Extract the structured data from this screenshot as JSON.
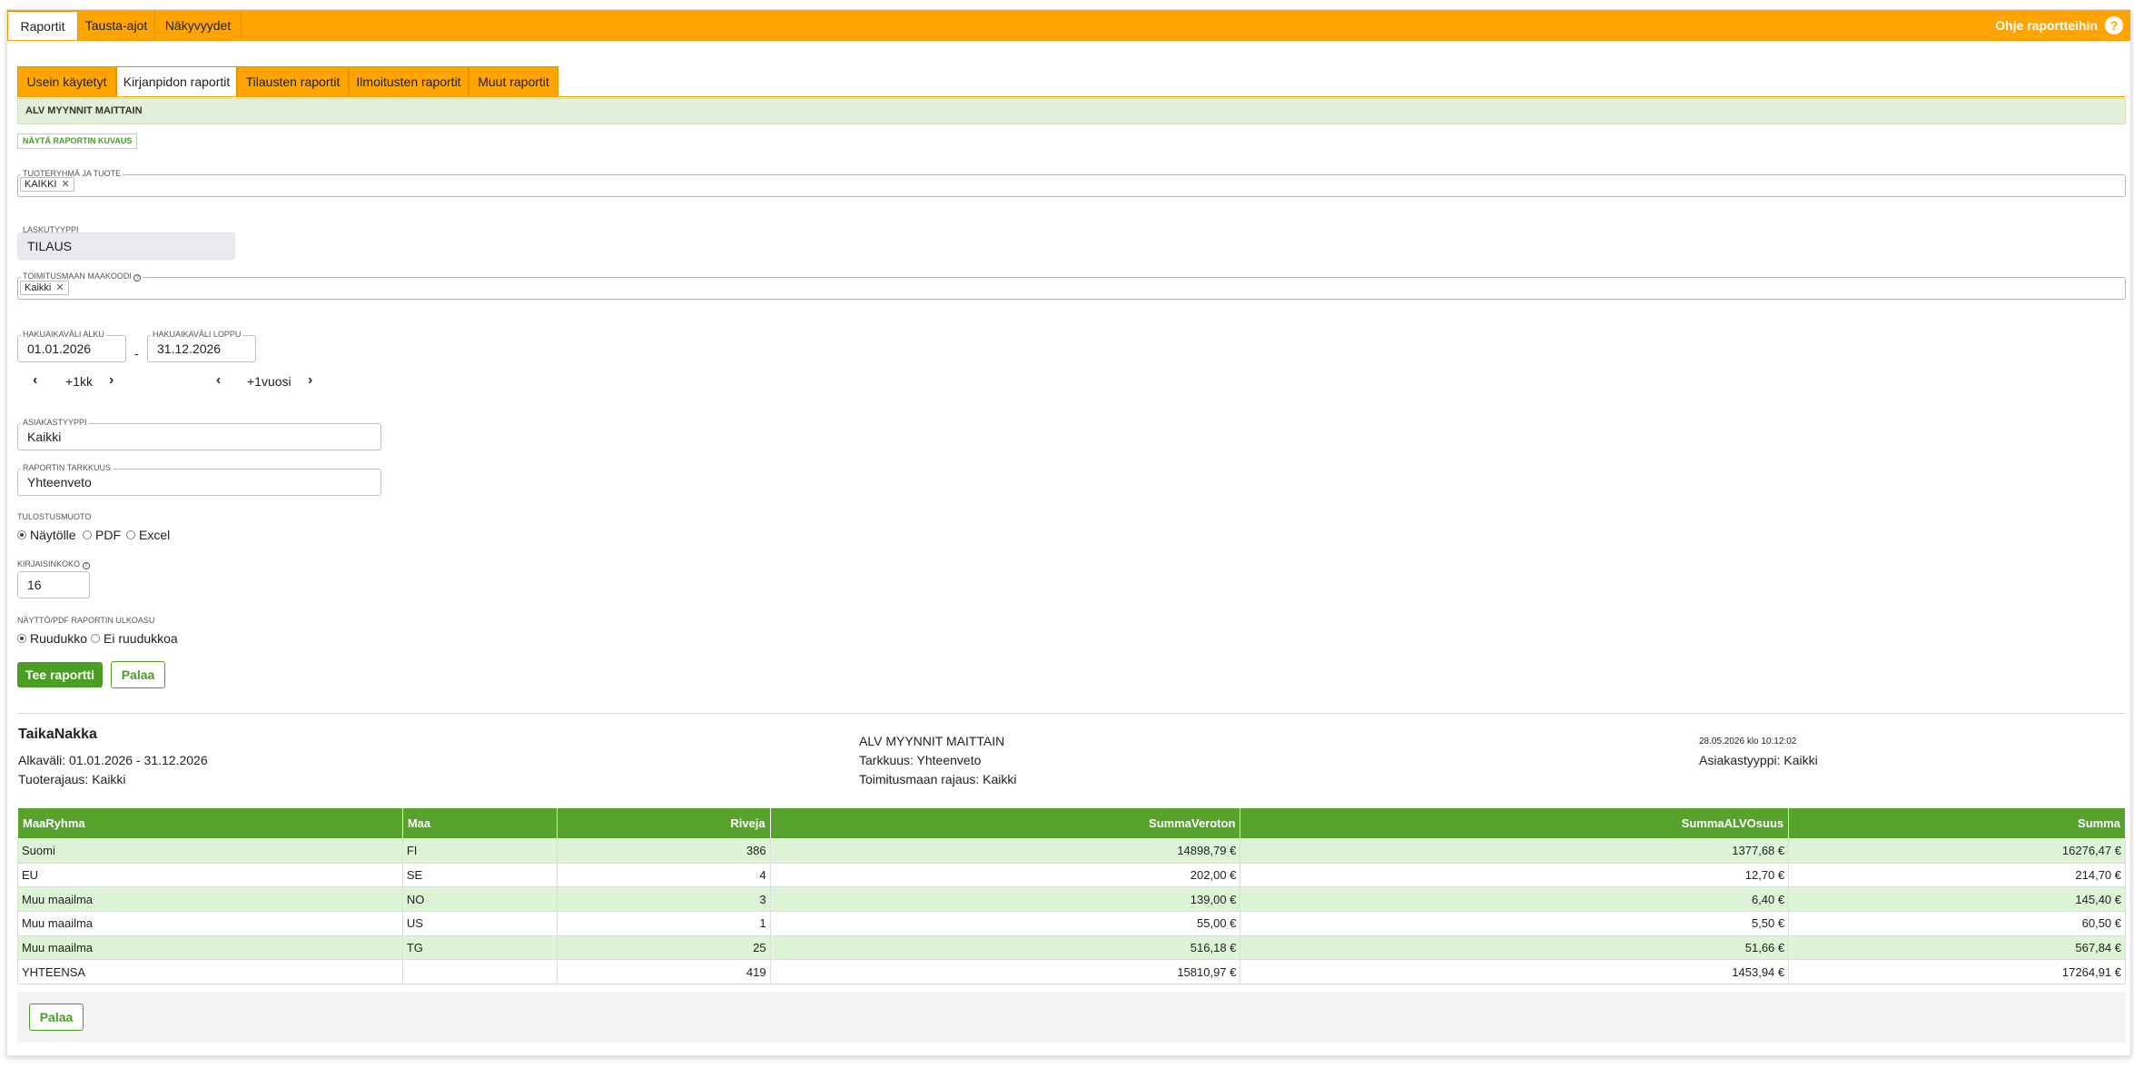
{
  "topbar": {
    "tabs": [
      "Raportit",
      "Tausta-ajot",
      "Näkyvyydet"
    ],
    "help_label": "Ohje raportteihin",
    "help_icon": "?"
  },
  "subtabs": [
    "Usein käytetyt",
    "Kirjanpidon raportit",
    "Tilausten raportit",
    "Ilmoitusten raportit",
    "Muut raportit"
  ],
  "report_title": "ALV MYYNNIT MAITTAIN",
  "show_description": "NÄYTÄ RAPORTIN KUVAUS",
  "form": {
    "product_group": {
      "label": "TUOTERYHMÄ JA TUOTE",
      "chip": "KAIKKI"
    },
    "invoice_type": {
      "label": "LASKUTYYPPI",
      "value": "TILAUS"
    },
    "country_code": {
      "label": "TOIMITUSMAAN MAAKOODI",
      "chip": "Kaikki"
    },
    "start": {
      "label": "HAKUAIKAVÄLI ALKU",
      "value": "01.01.2026"
    },
    "end": {
      "label": "HAKUAIKAVÄLI LOPPU",
      "value": "31.12.2026"
    },
    "separator": "-",
    "step_month": "+1kk",
    "step_year": "+1vuosi",
    "customer_type": {
      "label": "ASIAKASTYYPPI",
      "value": "Kaikki"
    },
    "precision": {
      "label": "RAPORTIN TARKKUUS",
      "value": "Yhteenveto"
    },
    "output": {
      "label": "TULOSTUSMUOTO",
      "options": [
        "Näytölle",
        "PDF",
        "Excel"
      ]
    },
    "font_size": {
      "label": "KIRJAISINKOKO",
      "value": "16"
    },
    "layout": {
      "label": "NÄYTTÖ/PDF RAPORTIN ULKOASU",
      "options": [
        "Ruudukko",
        "Ei ruudukkoa"
      ]
    },
    "submit": "Tee raportti",
    "back": "Palaa"
  },
  "report": {
    "company": "TaikaNakka",
    "period": "Alkaväli: 01.01.2026 - 31.12.2026",
    "product_filter": "Tuoterajaus: Kaikki",
    "name": "ALV MYYNNIT MAITTAIN",
    "precision": "Tarkkuus: Yhteenveto",
    "country_filter": "Toimitusmaan rajaus: Kaikki",
    "timestamp": "28.05.2026 klo 10:12:02",
    "customer_type": "Asiakastyyppi: Kaikki"
  },
  "table": {
    "headers": [
      "MaaRyhma",
      "Maa",
      "Riveja",
      "SummaVeroton",
      "SummaALVOsuus",
      "Summa"
    ],
    "rows": [
      [
        "Suomi",
        "FI",
        "386",
        "14898,79 €",
        "1377,68 €",
        "16276,47 €"
      ],
      [
        "EU",
        "SE",
        "4",
        "202,00 €",
        "12,70 €",
        "214,70 €"
      ],
      [
        "Muu maailma",
        "NO",
        "3",
        "139,00 €",
        "6,40 €",
        "145,40 €"
      ],
      [
        "Muu maailma",
        "US",
        "1",
        "55,00 €",
        "5,50 €",
        "60,50 €"
      ],
      [
        "Muu maailma",
        "TG",
        "25",
        "516,18 €",
        "51,66 €",
        "567,84 €"
      ],
      [
        "YHTEENSA",
        "",
        "419",
        "15810,97 €",
        "1453,94 €",
        "17264,91 €"
      ]
    ]
  },
  "footer_back": "Palaa"
}
